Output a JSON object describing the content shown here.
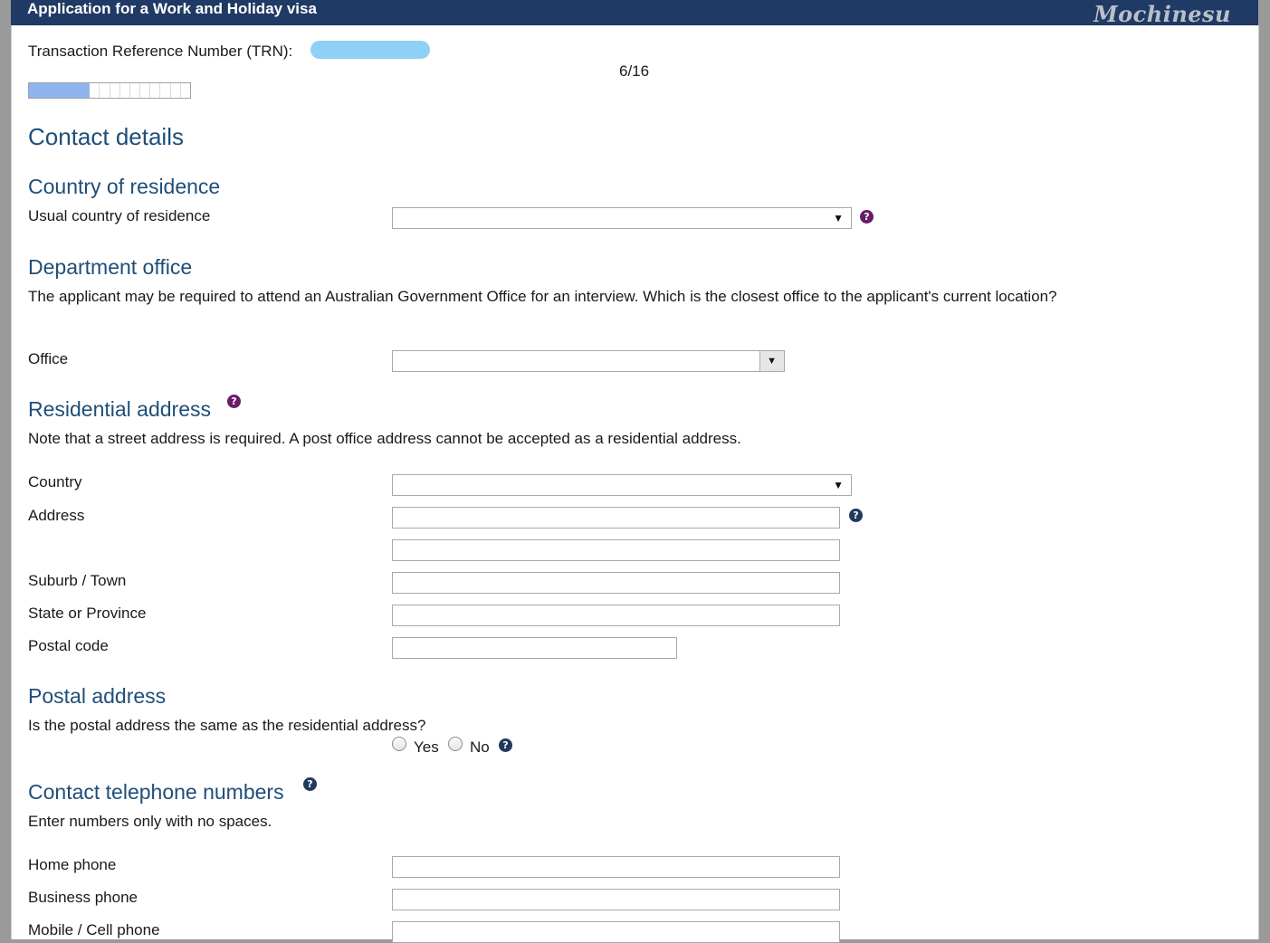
{
  "header": {
    "title": "Application for a Work and Holiday visa",
    "watermark": "Mochinesu"
  },
  "trn": {
    "label": "Transaction Reference Number (TRN):"
  },
  "progress": {
    "text": "6/16",
    "current": 6,
    "total": 16
  },
  "sections": {
    "contact_details": "Contact details",
    "country_of_residence": "Country of residence",
    "department_office": "Department office",
    "residential_address": "Residential address",
    "postal_address": "Postal address",
    "contact_phone": "Contact telephone numbers"
  },
  "labels": {
    "usual_country": "Usual country of residence",
    "office": "Office",
    "country": "Country",
    "address": "Address",
    "suburb": "Suburb / Town",
    "state": "State or Province",
    "postal_code": "Postal code",
    "postal_same": "Is the postal address the same as the residential address?",
    "yes": "Yes",
    "no": "No",
    "home_phone": "Home phone",
    "business_phone": "Business phone",
    "mobile_phone": "Mobile / Cell phone"
  },
  "texts": {
    "office_note": "The applicant may be required to attend an Australian Government Office for an interview. Which is the closest office to the applicant's current location?",
    "residential_note": "Note that a street address is required. A post office address cannot be accepted as a residential address.",
    "phone_note": "Enter numbers only with no spaces."
  },
  "icons": {
    "dropdown": "▼",
    "help": "?"
  },
  "colors": {
    "header_bg": "#1f3a64",
    "heading": "#1f4e79",
    "progress_fill": "#8fb4ef",
    "help_purple": "#6a1b6b",
    "help_navy": "#1f3a5c"
  }
}
